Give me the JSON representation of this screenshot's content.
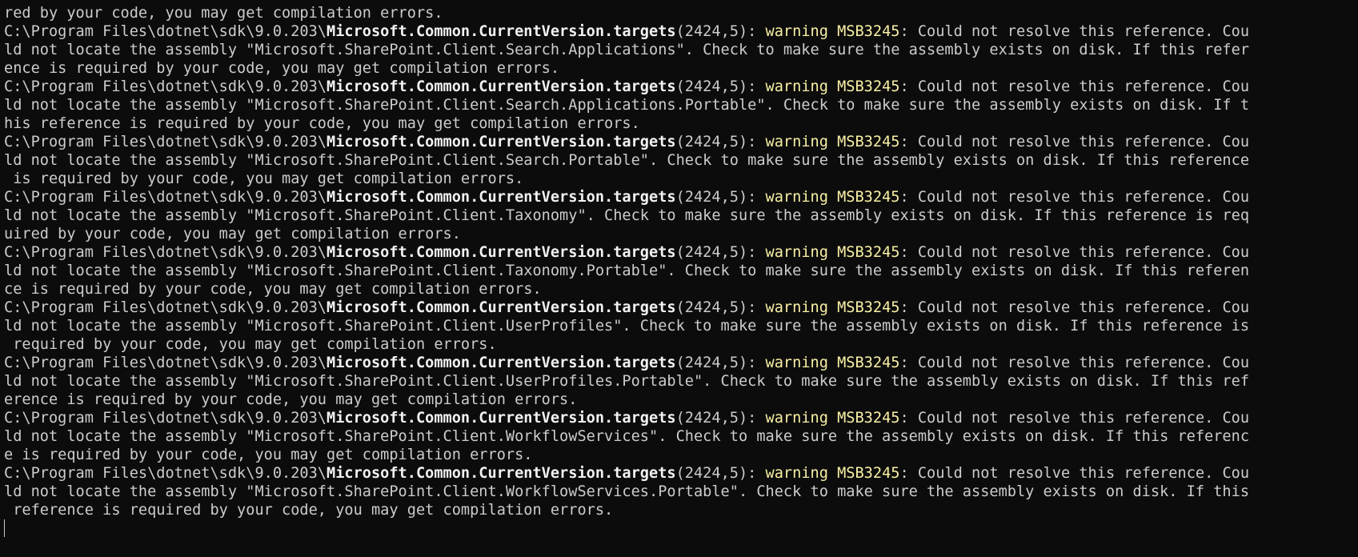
{
  "terminal": {
    "top_continuation": "red by your code, you may get compilation errors.",
    "path_prefix": "C:\\Program Files\\dotnet\\sdk\\9.0.203\\",
    "targets_file": "Microsoft.Common.CurrentVersion.targets",
    "location": "(2424,5): ",
    "warning_label": "warning MSB3245",
    "warnings": [
      {
        "first_rest": ": Could not resolve this reference. Cou",
        "second": "ld not locate the assembly \"Microsoft.SharePoint.Client.Search.Applications\". Check to make sure the assembly exists on disk. If this refer",
        "third": "ence is required by your code, you may get compilation errors."
      },
      {
        "first_rest": ": Could not resolve this reference. Cou",
        "second": "ld not locate the assembly \"Microsoft.SharePoint.Client.Search.Applications.Portable\". Check to make sure the assembly exists on disk. If t",
        "third": "his reference is required by your code, you may get compilation errors."
      },
      {
        "first_rest": ": Could not resolve this reference. Cou",
        "second": "ld not locate the assembly \"Microsoft.SharePoint.Client.Search.Portable\". Check to make sure the assembly exists on disk. If this reference",
        "third": " is required by your code, you may get compilation errors."
      },
      {
        "first_rest": ": Could not resolve this reference. Cou",
        "second": "ld not locate the assembly \"Microsoft.SharePoint.Client.Taxonomy\". Check to make sure the assembly exists on disk. If this reference is req",
        "third": "uired by your code, you may get compilation errors."
      },
      {
        "first_rest": ": Could not resolve this reference. Cou",
        "second": "ld not locate the assembly \"Microsoft.SharePoint.Client.Taxonomy.Portable\". Check to make sure the assembly exists on disk. If this referen",
        "third": "ce is required by your code, you may get compilation errors."
      },
      {
        "first_rest": ": Could not resolve this reference. Cou",
        "second": "ld not locate the assembly \"Microsoft.SharePoint.Client.UserProfiles\". Check to make sure the assembly exists on disk. If this reference is",
        "third": " required by your code, you may get compilation errors."
      },
      {
        "first_rest": ": Could not resolve this reference. Cou",
        "second": "ld not locate the assembly \"Microsoft.SharePoint.Client.UserProfiles.Portable\". Check to make sure the assembly exists on disk. If this ref",
        "third": "erence is required by your code, you may get compilation errors."
      },
      {
        "first_rest": ": Could not resolve this reference. Cou",
        "second": "ld not locate the assembly \"Microsoft.SharePoint.Client.WorkflowServices\". Check to make sure the assembly exists on disk. If this referenc",
        "third": "e is required by your code, you may get compilation errors."
      },
      {
        "first_rest": ": Could not resolve this reference. Cou",
        "second": "ld not locate the assembly \"Microsoft.SharePoint.Client.WorkflowServices.Portable\". Check to make sure the assembly exists on disk. If this",
        "third": " reference is required by your code, you may get compilation errors."
      }
    ],
    "colors": {
      "background": "#0c0c0c",
      "text": "#cccccc",
      "bold_text": "#f2f2f2",
      "warning": "#f9f1a5"
    }
  }
}
